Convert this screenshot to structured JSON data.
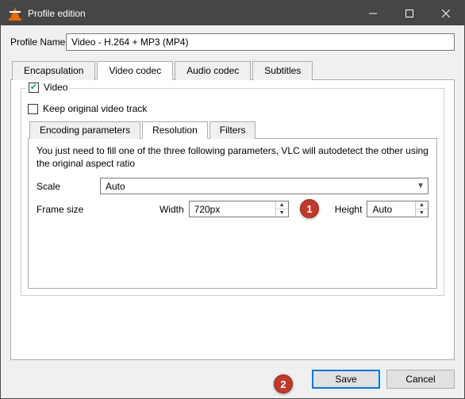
{
  "window": {
    "title": "Profile edition"
  },
  "profile": {
    "label": "Profile Name",
    "value": "Video - H.264 + MP3 (MP4)"
  },
  "tabs": {
    "encapsulation": "Encapsulation",
    "video_codec": "Video codec",
    "audio_codec": "Audio codec",
    "subtitles": "Subtitles"
  },
  "video": {
    "checkbox_label": "Video",
    "keep_original": "Keep original video track",
    "subtabs": {
      "encoding": "Encoding parameters",
      "resolution": "Resolution",
      "filters": "Filters"
    },
    "resolution": {
      "help": "You just need to fill one of the three following parameters, VLC will autodetect the other using the original aspect ratio",
      "scale_label": "Scale",
      "scale_value": "Auto",
      "frame_size_label": "Frame size",
      "width_label": "Width",
      "width_value": "720px",
      "height_label": "Height",
      "height_value": "Auto"
    }
  },
  "buttons": {
    "save": "Save",
    "cancel": "Cancel"
  },
  "callouts": {
    "one": "1",
    "two": "2"
  }
}
